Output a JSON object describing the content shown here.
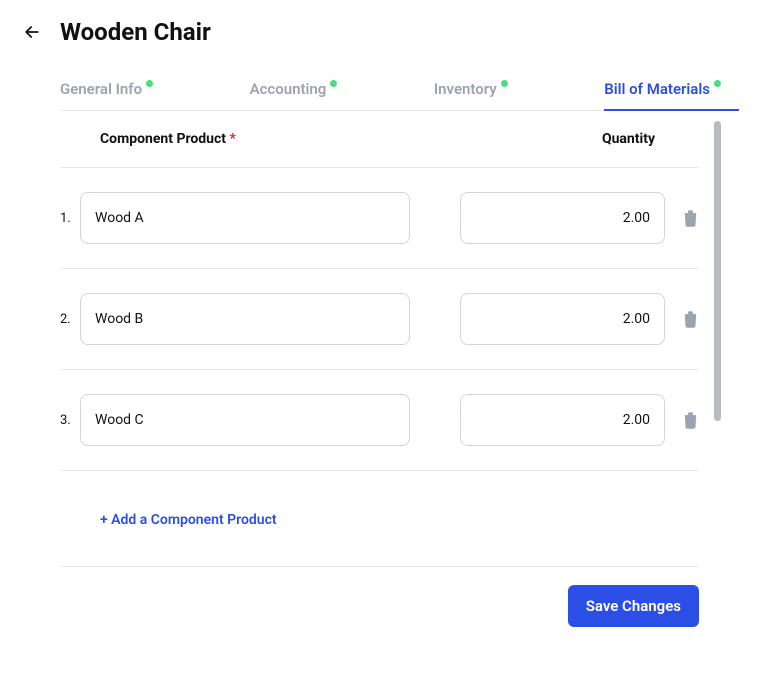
{
  "header": {
    "title": "Wooden Chair"
  },
  "tabs": [
    {
      "label": "General Info",
      "active": false,
      "hasDot": true
    },
    {
      "label": "Accounting",
      "active": false,
      "hasDot": true
    },
    {
      "label": "Inventory",
      "active": false,
      "hasDot": true
    },
    {
      "label": "Bill of Materials",
      "active": true,
      "hasDot": true
    }
  ],
  "table": {
    "productHeader": "Component Product",
    "requiredMark": "*",
    "qtyHeader": "Quantity",
    "rows": [
      {
        "index": "1.",
        "product": "Wood A",
        "quantity": "2.00"
      },
      {
        "index": "2.",
        "product": "Wood B",
        "quantity": "2.00"
      },
      {
        "index": "3.",
        "product": "Wood C",
        "quantity": "2.00"
      }
    ],
    "addLabel": "+ Add a Component Product"
  },
  "footer": {
    "saveLabel": "Save Changes"
  }
}
